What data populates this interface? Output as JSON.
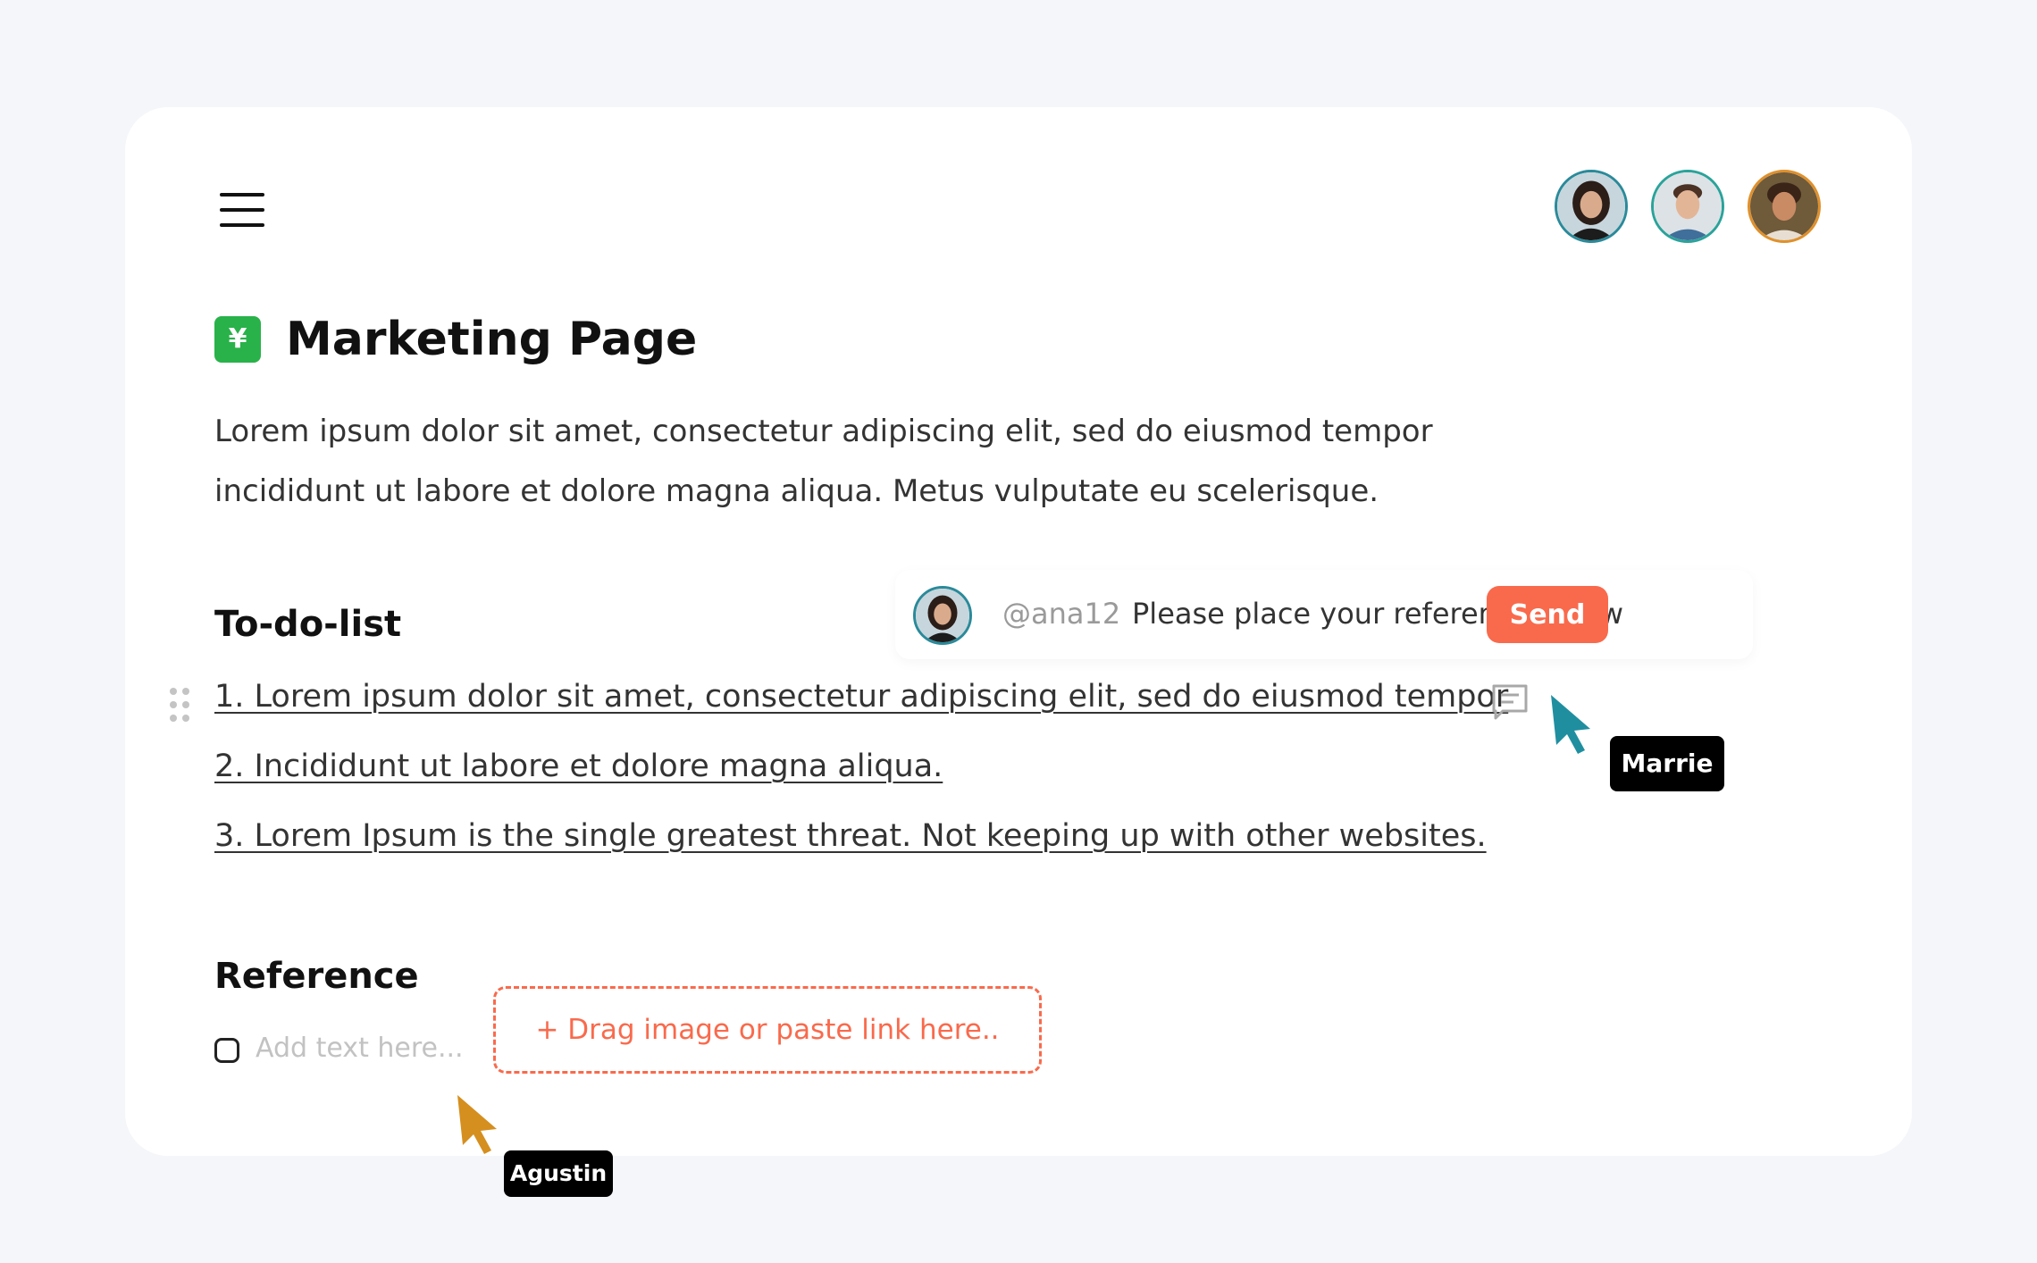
{
  "page": {
    "title": "Marketing Page",
    "title_emoji": "¥",
    "intro_line1": "Lorem ipsum dolor sit amet, consectetur adipiscing elit, sed do eiusmod tempor",
    "intro_line2": "incididunt ut labore et dolore magna aliqua. Metus vulputate eu scelerisque."
  },
  "header": {
    "menu_icon": "hamburger-menu-icon",
    "collaborators": [
      {
        "name": "collaborator-1",
        "ring_color": "#2a8a9a"
      },
      {
        "name": "collaborator-2",
        "ring_color": "#2aa39a"
      },
      {
        "name": "collaborator-3",
        "ring_color": "#e0902a"
      }
    ]
  },
  "todo": {
    "heading": "To-do-list",
    "items": [
      "1. Lorem ipsum dolor sit amet, consectetur adipiscing elit, sed do eiusmod tempor",
      "2. Incididunt ut labore et dolore magna aliqua.",
      "3. Lorem Ipsum is the single greatest threat. Not keeping up with other websites."
    ]
  },
  "comment": {
    "mention": "@ana12",
    "text": "Please place your reference below",
    "send_label": "Send",
    "accent": "#f96a4c"
  },
  "reference": {
    "heading": "Reference",
    "input_placeholder": "Add text here...",
    "dropzone_label": "+ Drag image or paste link here.."
  },
  "cursors": {
    "marrie": {
      "label": "Marrie",
      "color": "#1f8fa0"
    },
    "agustin": {
      "label": "Agustin",
      "color": "#d58f1f"
    }
  }
}
